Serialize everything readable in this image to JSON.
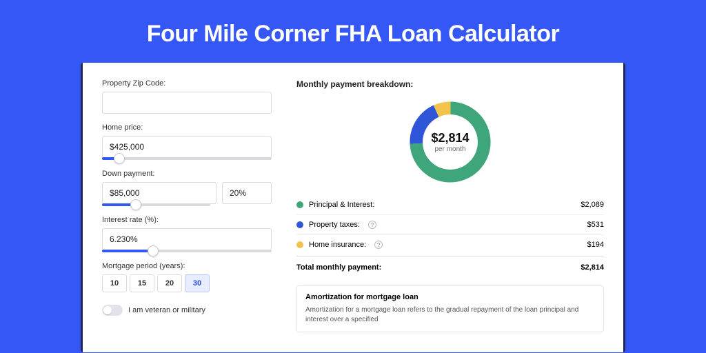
{
  "title": "Four Mile Corner FHA Loan Calculator",
  "left": {
    "zip_label": "Property Zip Code:",
    "zip_value": "",
    "home_price_label": "Home price:",
    "home_price_value": "$425,000",
    "home_price_pct": 10,
    "down_label": "Down payment:",
    "down_value": "$85,000",
    "down_pct_value": "20%",
    "down_slider_pct": 20,
    "rate_label": "Interest rate (%):",
    "rate_value": "6.230%",
    "rate_slider_pct": 30,
    "period_label": "Mortgage period (years):",
    "periods": [
      "10",
      "15",
      "20",
      "30"
    ],
    "period_active_index": 3,
    "veteran_label": "I am veteran or military",
    "veteran_on": false
  },
  "right": {
    "breakdown_title": "Monthly payment breakdown:",
    "center_amount": "$2,814",
    "center_sub": "per month",
    "items": [
      {
        "label": "Principal & Interest:",
        "value": "$2,089",
        "color": "#3fa57a",
        "has_info": false
      },
      {
        "label": "Property taxes:",
        "value": "$531",
        "color": "#2f56d9",
        "has_info": true
      },
      {
        "label": "Home insurance:",
        "value": "$194",
        "color": "#f2c44c",
        "has_info": true
      }
    ],
    "total_label": "Total monthly payment:",
    "total_value": "$2,814",
    "amort_title": "Amortization for mortgage loan",
    "amort_text": "Amortization for a mortgage loan refers to the gradual repayment of the loan principal and interest over a specified"
  },
  "chart_data": {
    "type": "pie",
    "title": "Monthly payment breakdown",
    "categories": [
      "Principal & Interest",
      "Property taxes",
      "Home insurance"
    ],
    "values": [
      2089,
      531,
      194
    ],
    "colors": [
      "#3fa57a",
      "#2f56d9",
      "#f2c44c"
    ],
    "total": 2814,
    "center_label": "$2,814 per month"
  }
}
